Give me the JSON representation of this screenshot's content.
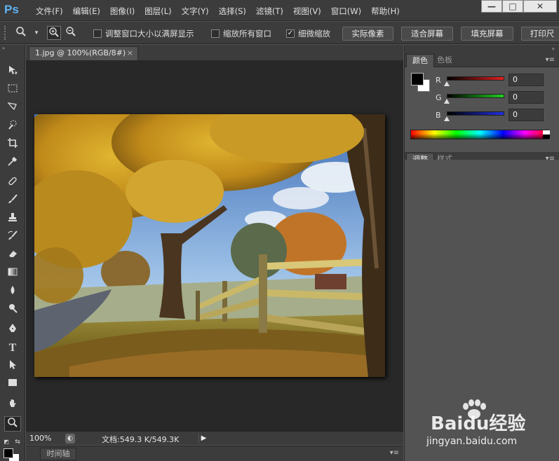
{
  "app": {
    "logo": "Ps",
    "menu": [
      "文件(F)",
      "编辑(E)",
      "图像(I)",
      "图层(L)",
      "文字(Y)",
      "选择(S)",
      "滤镜(T)",
      "视图(V)",
      "窗口(W)",
      "帮助(H)"
    ],
    "window_buttons": [
      "—",
      "□",
      "✕"
    ]
  },
  "options_bar": {
    "zoom_tool_icon": "magnifier-icon",
    "checkboxes": [
      {
        "label": "调整窗口大小以满屏显示",
        "checked": false
      },
      {
        "label": "缩放所有窗口",
        "checked": false
      },
      {
        "label": "细微缩放",
        "checked": true
      }
    ],
    "buttons": [
      "实际像素",
      "适合屏幕",
      "填充屏幕",
      "打印尺"
    ]
  },
  "document": {
    "tab_title": "1.jpg @ 100%(RGB/8#)",
    "tab_close": "×"
  },
  "status": {
    "zoom": "100%",
    "doc_info": "文档:549.3 K/549.3K"
  },
  "timeline": {
    "tab_label": "时间轴"
  },
  "color_panel": {
    "tabs": [
      "颜色",
      "色板"
    ],
    "channels": [
      {
        "label": "R",
        "value": "0",
        "color": "#e02020"
      },
      {
        "label": "G",
        "value": "0",
        "color": "#20d020"
      },
      {
        "label": "B",
        "value": "0",
        "color": "#2030e0"
      }
    ],
    "foreground": "#000000",
    "background": "#ffffff"
  },
  "adjust_panel": {
    "tabs": [
      "调整",
      "样式"
    ]
  },
  "watermark": {
    "brand": "Baidu经验",
    "url": "jingyan.baidu.com"
  }
}
